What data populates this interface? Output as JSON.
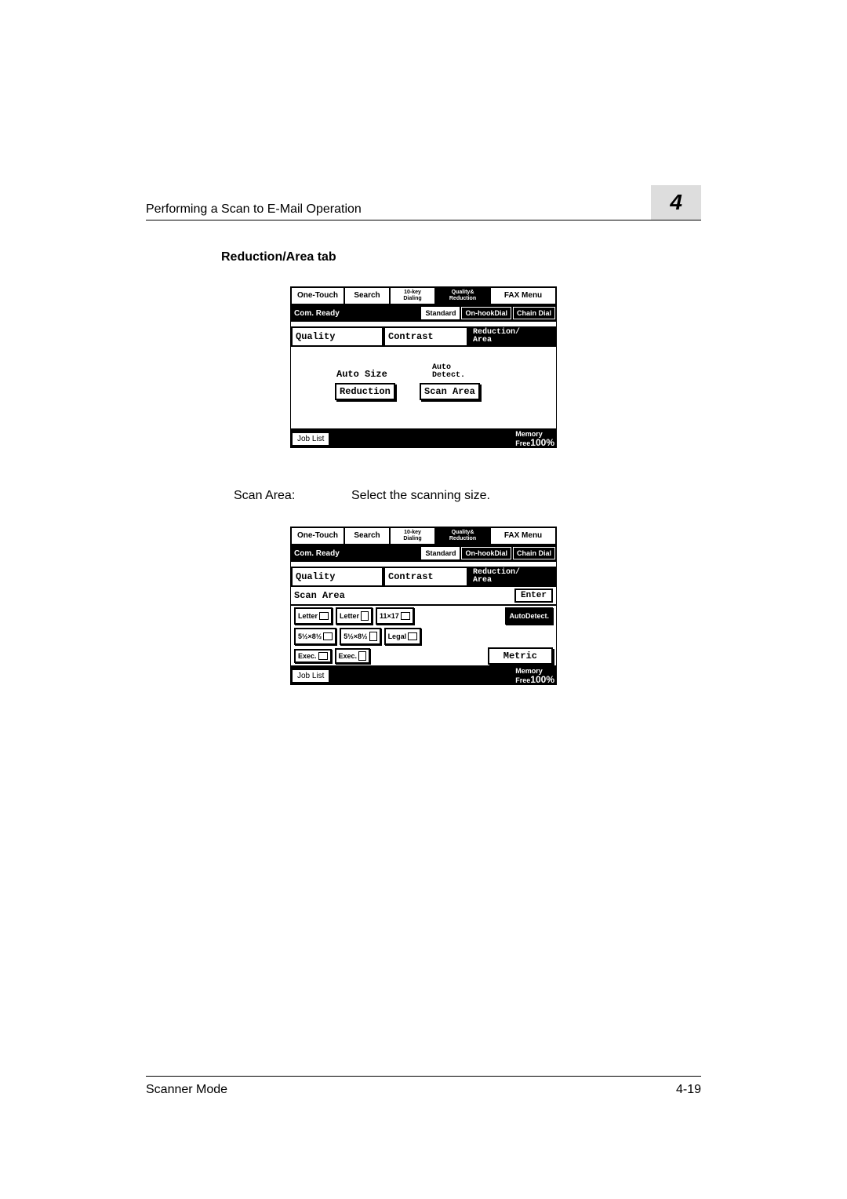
{
  "header": {
    "title": "Performing a Scan to E-Mail Operation",
    "chapter": "4"
  },
  "section_heading": "Reduction/Area tab",
  "tabs": {
    "one_touch": "One-Touch",
    "search": "Search",
    "ten_key": "10-key\nDialing",
    "quality_reduction": "Quality&\nReduction",
    "fax_menu": "FAX Menu"
  },
  "status": {
    "com_ready": "Com. Ready",
    "standard": "Standard",
    "on_hook": "On-hookDial",
    "chain": "Chain Dial"
  },
  "subtabs": {
    "quality": "Quality",
    "contrast": "Contrast",
    "reduction_area": "Reduction/\nArea"
  },
  "screen1": {
    "auto_size": "Auto Size",
    "auto_detect": "Auto\nDetect.",
    "reduction": "Reduction",
    "scan_area": "Scan Area"
  },
  "kv": {
    "label": "Scan Area:",
    "value": "Select the scanning size."
  },
  "screen2": {
    "scan_area_label": "Scan Area",
    "enter": "Enter",
    "sizes_row1": [
      "Letter",
      "Letter",
      "11×17",
      "AutoDetect."
    ],
    "sizes_row2": [
      "5½×8½",
      "5½×8½",
      "Legal"
    ],
    "sizes_row3": [
      "Exec.",
      "Exec."
    ],
    "metric": "Metric"
  },
  "job_list": "Job List",
  "memory": {
    "label": "Memory\nFree",
    "value": "100%"
  },
  "footer": {
    "left": "Scanner Mode",
    "right": "4-19"
  }
}
